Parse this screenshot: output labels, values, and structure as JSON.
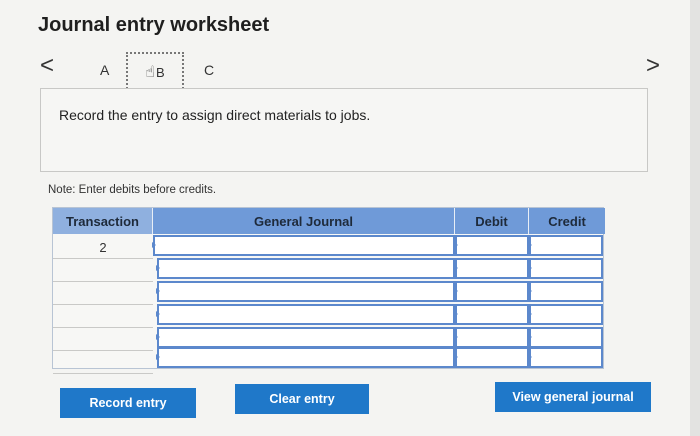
{
  "header": {
    "title": "Journal entry worksheet"
  },
  "nav": {
    "prev_icon": "chevron-left-icon",
    "next_icon": "chevron-right-icon",
    "prev_glyph": "<",
    "next_glyph": ">",
    "tabs": [
      {
        "label": "A",
        "active": false
      },
      {
        "label": "B",
        "active": true
      },
      {
        "label": "C",
        "active": false
      }
    ]
  },
  "prompt": {
    "text": "Record the entry to assign direct materials to jobs."
  },
  "note": {
    "text": "Note: Enter debits before credits."
  },
  "journal": {
    "columns": {
      "transaction": "Transaction",
      "general_journal": "General Journal",
      "debit": "Debit",
      "credit": "Credit"
    },
    "rows": [
      {
        "transaction": "2",
        "account": "",
        "debit": "",
        "credit": ""
      },
      {
        "transaction": "",
        "account": "",
        "debit": "",
        "credit": ""
      },
      {
        "transaction": "",
        "account": "",
        "debit": "",
        "credit": ""
      },
      {
        "transaction": "",
        "account": "",
        "debit": "",
        "credit": ""
      },
      {
        "transaction": "",
        "account": "",
        "debit": "",
        "credit": ""
      },
      {
        "transaction": "",
        "account": "",
        "debit": "",
        "credit": ""
      }
    ]
  },
  "buttons": {
    "record": "Record entry",
    "clear": "Clear entry",
    "view": "View general journal"
  },
  "colors": {
    "accent": "#1f78c9",
    "header": "#6f9ad8",
    "cell_border": "#5c88cc"
  }
}
